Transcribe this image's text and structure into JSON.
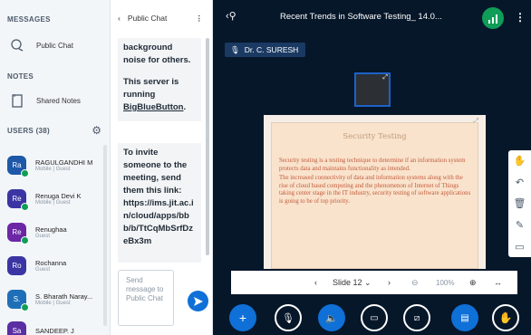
{
  "sidebar": {
    "messages_header": "MESSAGES",
    "public_chat_label": "Public Chat",
    "notes_header": "NOTES",
    "shared_notes_label": "Shared Notes",
    "users_header": "USERS (38)",
    "users": [
      {
        "initials": "Ra",
        "name": "RAGULGANDHI M",
        "role": "Mobile | Guest",
        "color": "#1e58a8",
        "mic": true
      },
      {
        "initials": "Re",
        "name": "Renuga Devi K",
        "role": "Mobile | Guest",
        "color": "#3b35a3",
        "mic": true
      },
      {
        "initials": "Re",
        "name": "Renughaa",
        "role": "Guest",
        "color": "#6b27a6",
        "mic": true
      },
      {
        "initials": "Ro",
        "name": "Rochanna",
        "role": "Guest",
        "color": "#3b35a3",
        "mic": false
      },
      {
        "initials": "S.",
        "name": "S. Bharath Naray...",
        "role": "Mobile | Guest",
        "color": "#1e6fb8",
        "mic": true
      },
      {
        "initials": "Sa",
        "name": "SANDEEP. J",
        "role": "",
        "color": "#5b2ea3",
        "mic": false
      }
    ]
  },
  "chat": {
    "back_label": "Public Chat",
    "msg1_text": "background noise for others.",
    "msg1_line2": "This server is running",
    "msg1_link": "BigBlueButton",
    "msg1_end": ".",
    "msg2_text": "To invite someone to the meeting, send them this link:",
    "msg2_link": "https://ims.jit.ac.in/cloud/apps/bbb/b/TtCqMbSrfDzeBx3m",
    "input_placeholder": "Send message to Public Chat"
  },
  "meeting": {
    "title": "Recent Trends in Software Testing_ 14.0...",
    "presenter": "Dr. C. SURESH"
  },
  "slide": {
    "title": "Security Testing",
    "para1": "Security testing is a testing technique to determine if an information system protects data and maintains functionality as intended.",
    "para2": "The increased connectivity of data and information systems along with the rise of cloud based computing and the phenomenon of Internet of Things taking center stage in the IT industry, security testing of software applications is going to be of top priority."
  },
  "navigation": {
    "slide_label": "Slide 12",
    "zoom": "100%"
  },
  "colors": {
    "accent": "#0f70d7",
    "dark_bg": "#06172a",
    "status_green": "#0f9d58"
  }
}
